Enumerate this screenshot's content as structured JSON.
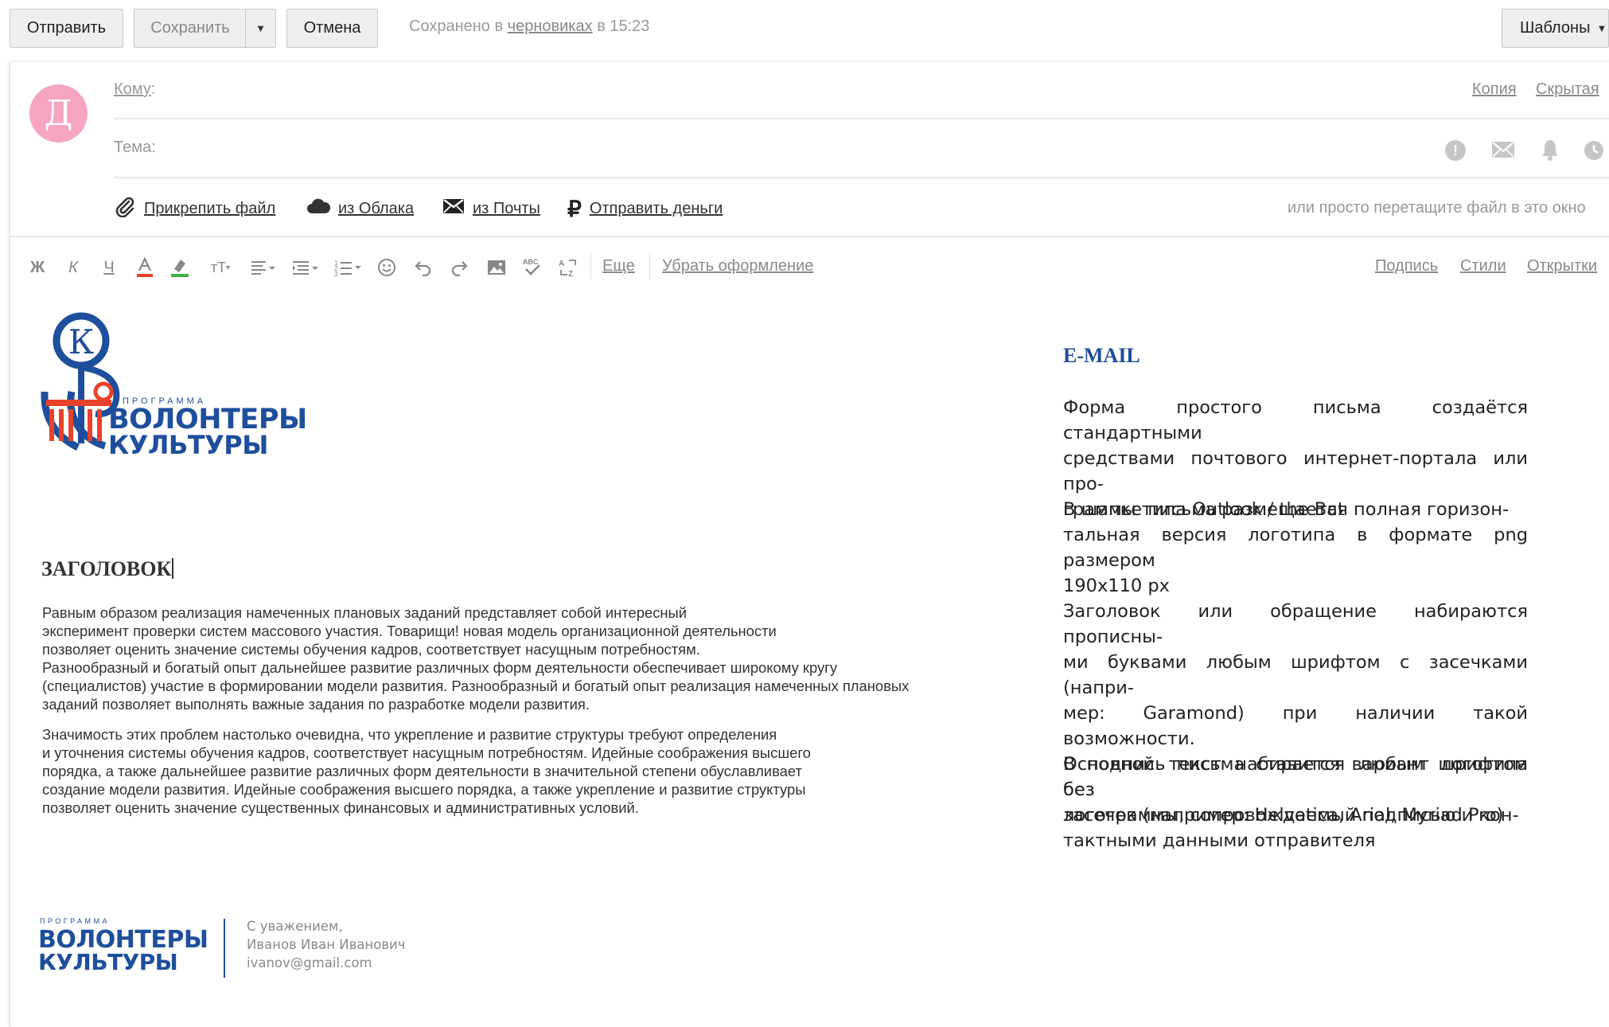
{
  "toolbar": {
    "send_label": "Отправить",
    "save_label": "Сохранить",
    "cancel_label": "Отмена",
    "saved_prefix": "Сохранено в",
    "saved_link": "черновиках",
    "saved_suffix": "в 15:23",
    "templates_label": "Шаблоны"
  },
  "compose": {
    "avatar_letter": "Д",
    "to_label": "Кому",
    "cc_link": "Копия",
    "bcc_link": "Скрытая",
    "subject_label": "Тема:",
    "attach_file": "Прикрепить файл",
    "from_cloud": "из Облака",
    "from_mail": "из Почты",
    "send_money": "Отправить деньги",
    "drag_hint": "или просто перетащите файл в это окно"
  },
  "editor": {
    "bold": "Ж",
    "italic": "К",
    "underline": "Ч",
    "more": "Еще",
    "clear_format": "Убрать оформление",
    "signature_link": "Подпись",
    "styles_link": "Стили",
    "cards_link": "Открытки"
  },
  "letter": {
    "logo_top": "ПРОГРАММА",
    "logo_line1": "ВОЛОНТЕРЫ",
    "logo_line2": "КУЛЬТУРЫ",
    "logo_monogram": "К",
    "heading": "ЗАГОЛОВОК",
    "paragraph1": "Равным образом реализация намеченных плановых заданий представляет собой интересный\nэксперимент проверки систем массового участия. Товарищи! новая модель организационной деятельности\nпозволяет оценить значение системы обучения кадров, соответствует насущным потребностям.\nРазнообразный и богатый опыт дальнейшее развитие различных форм деятельности обеспечивает широкому кругу\n(специалистов) участие в формировании модели развития. Разнообразный и богатый опыт реализация намеченных плановых\nзаданий позволяет выполнять важные задания по разработке модели развития.",
    "paragraph2": "Значимость этих проблем настолько очевидна, что укрепление и развитие структуры требуют определения\nи уточнения системы обучения кадров, соответствует насущным потребностям. Идейные соображения высшего\nпорядка, а также дальнейшее развитие различных форм деятельности в значительной степени обуславливает\nсоздание модели развития. Идейные соображения высшего порядка, а также укрепление и развитие структуры\nпозволяет оценить значение существенных финансовых и административных условий.",
    "signature": {
      "logo_top": "ПРОГРАММА",
      "logo_line1": "ВОЛОНТЕРЫ",
      "logo_line2": "КУЛЬТУРЫ",
      "regards": "С уважением,",
      "name": "Иванов Иван Иванович",
      "email": "ivanov@gmail.com"
    }
  },
  "guide": {
    "title": "E-MAIL",
    "p1": "Форма простого письма создаётся стандартными\nсредствами почтового интернет-портала или про-\nграммы типа Outlook / the Bat",
    "p2": "В шапке письма размещается полная горизон-\nтальная версия логотипа в формате png размером\n190x110 px",
    "p3": "Заголовок или обращение набираются прописны-\nми буквами любым шрифтом с засечками (напри-\nмер: Garamond) при наличии такой возможности.\nОсновной текст набирается любым шрифтом без\nзасечек (например: Helvetica, Arial, Myriad Pro)",
    "p4": "В подпись письма ставится вариант логотипа без\nлогограммы, сопровождаемый подписью и кон-\nтактными данными отправителя"
  },
  "colors": {
    "brand_blue": "#1e4f9c",
    "brand_red": "#e8422a",
    "avatar_pink": "#f6a5c0",
    "guide_title": "#1f4e99"
  }
}
